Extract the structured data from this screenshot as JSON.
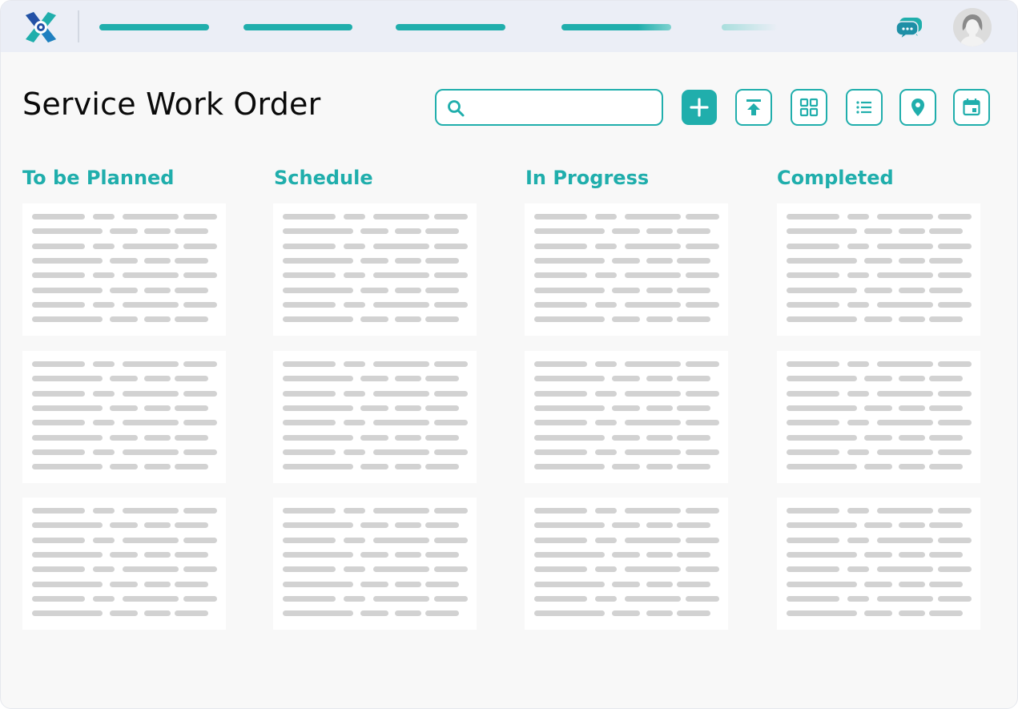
{
  "header": {
    "title": "Service Work Order",
    "nav_items": [
      "",
      "",
      "",
      "",
      ""
    ],
    "icons": {
      "logo": "app-logo-icon",
      "chat": "chat-icon",
      "avatar": "user-avatar-icon"
    }
  },
  "search": {
    "placeholder": "",
    "value": "",
    "icon": "search-icon"
  },
  "toolbar": {
    "buttons": [
      {
        "name": "add-button",
        "icon": "plus-icon"
      },
      {
        "name": "upload-button",
        "icon": "upload-icon"
      },
      {
        "name": "grid-view-button",
        "icon": "grid-icon"
      },
      {
        "name": "list-view-button",
        "icon": "list-icon"
      },
      {
        "name": "map-view-button",
        "icon": "location-pin-icon"
      },
      {
        "name": "calendar-view-button",
        "icon": "calendar-icon"
      }
    ]
  },
  "board": {
    "columns": [
      {
        "title": "To be Planned"
      },
      {
        "title": "Schedule"
      },
      {
        "title": "In Progress"
      },
      {
        "title": "Completed"
      }
    ],
    "cards_per_column": 3
  },
  "colors": {
    "accent": "#20aeac",
    "topbar": "#ebeef6",
    "background": "#f8f8f8",
    "placeholder": "#d2d2d2",
    "logo_dark": "#2451a6"
  }
}
